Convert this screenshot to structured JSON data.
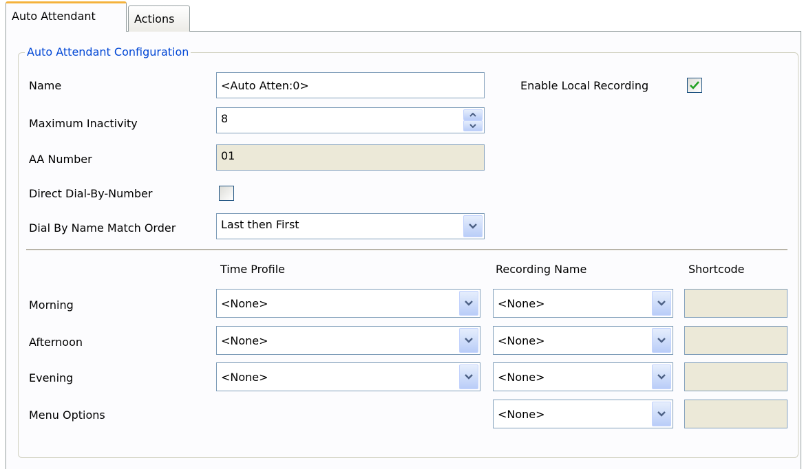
{
  "tabs": [
    {
      "label": "Auto Attendant",
      "active": true
    },
    {
      "label": "Actions",
      "active": false
    }
  ],
  "group": {
    "legend": "Auto Attendant Configuration"
  },
  "form": {
    "name": {
      "label": "Name",
      "value": "<Auto Atten:0>"
    },
    "max_inactivity": {
      "label": "Maximum Inactivity",
      "value": "8"
    },
    "aa_number": {
      "label": "AA Number",
      "value": "01"
    },
    "direct_dial": {
      "label": "Direct Dial-By-Number",
      "checked": false
    },
    "dial_by_name": {
      "label": "Dial By Name Match Order",
      "value": "Last then First"
    },
    "local_recording": {
      "label": "Enable Local Recording",
      "checked": true
    }
  },
  "schedule": {
    "headers": {
      "time_profile": "Time Profile",
      "recording_name": "Recording Name",
      "shortcode": "Shortcode"
    },
    "rows": [
      {
        "label": "Morning",
        "time_profile": "<None>",
        "recording": "<None>",
        "shortcode": ""
      },
      {
        "label": "Afternoon",
        "time_profile": "<None>",
        "recording": "<None>",
        "shortcode": ""
      },
      {
        "label": "Evening",
        "time_profile": "<None>",
        "recording": "<None>",
        "shortcode": ""
      },
      {
        "label": "Menu Options",
        "recording": "<None>",
        "shortcode": ""
      }
    ]
  },
  "icons": {
    "dropdown": "chevron-down-icon",
    "spinner": "spinner-arrows-icon",
    "check": "checkmark-icon"
  },
  "colors": {
    "accent_blue": "#0046d5",
    "tab_highlight": "#f4b23c",
    "check_green": "#21a121",
    "readonly_bg": "#ece9d8"
  }
}
